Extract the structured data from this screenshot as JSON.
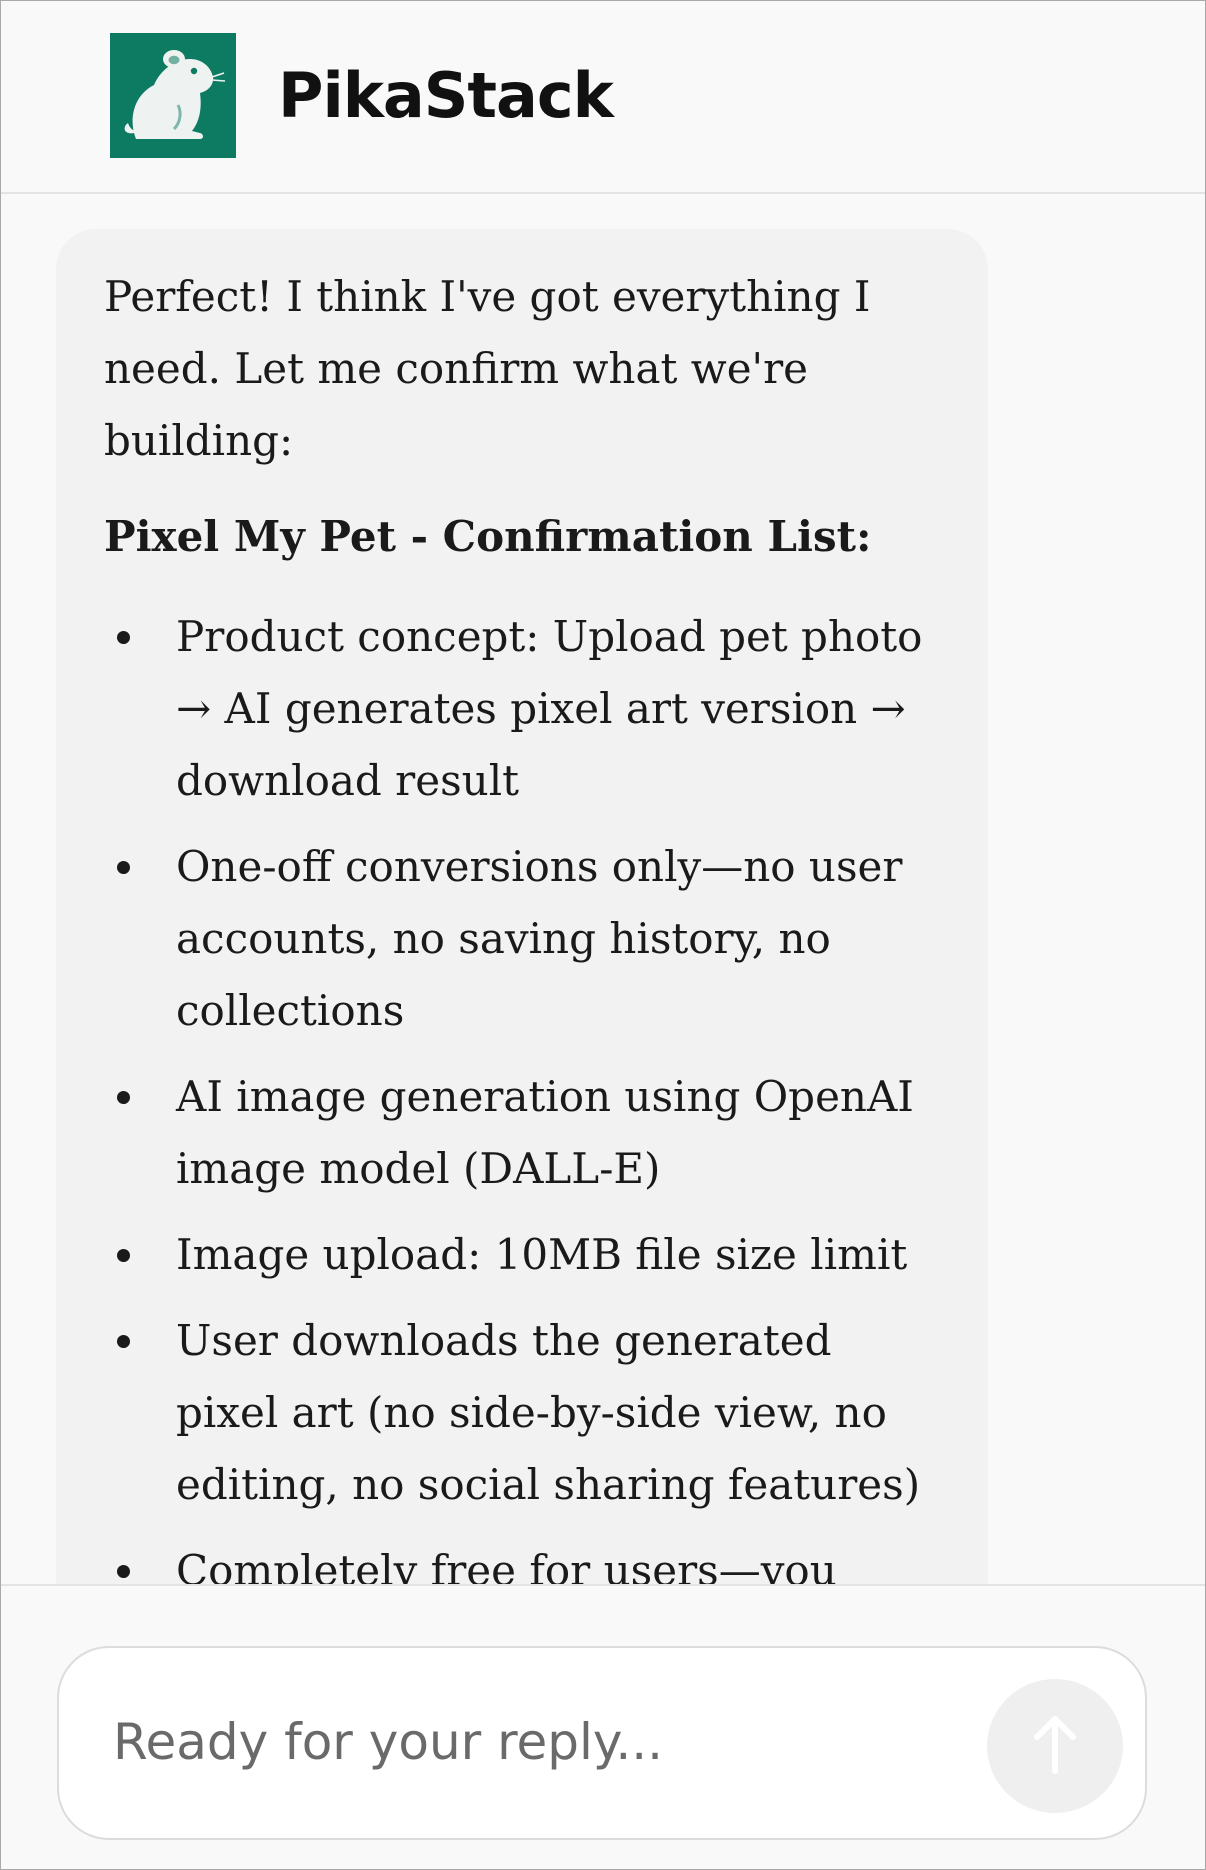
{
  "app": {
    "name": "PikaStack",
    "logo_icon": "hamster-icon",
    "accent_color": "#0d7a62"
  },
  "message": {
    "intro": "Perfect! I think I've got everything I need. Let me confirm what we're building:",
    "heading": "Pixel My Pet - Confirmation List:",
    "items": [
      "Product concept: Upload pet photo → AI generates pixel art version → download result",
      "One-off conversions only—no user accounts, no saving history, no collections",
      "AI image generation using OpenAI image model (DALL-E)",
      "Image upload: 10MB file size limit",
      "User downloads the generated pixel art (no side-by-side view, no editing, no social sharing features)",
      "Completely free for users—you"
    ]
  },
  "composer": {
    "placeholder": "Ready for your reply...",
    "send_icon": "arrow-up-icon"
  }
}
